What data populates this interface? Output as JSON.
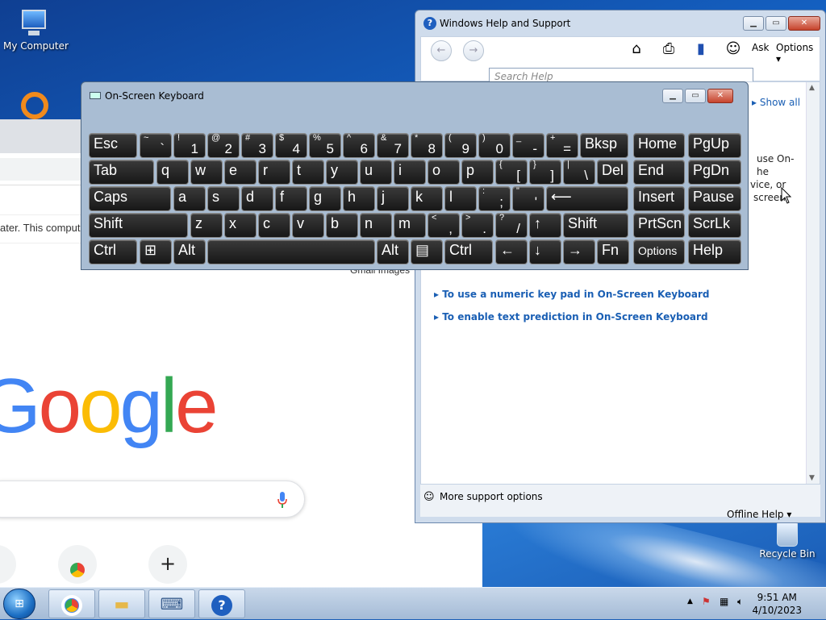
{
  "desktop": {
    "icons": {
      "my_computer": "My Computer",
      "recycle_bin": "Recycle Bin"
    }
  },
  "browser": {
    "info_text": "ater. This compute",
    "top_links": "Gmail   Images",
    "logo_text": "Google",
    "logo_colors": [
      "#4285F4",
      "#EA4335",
      "#FBBC05",
      "#4285F4",
      "#34A853",
      "#EA4335"
    ],
    "shortcut_plus": "+"
  },
  "help_window": {
    "title": "Windows Help and Support",
    "toolbar": {
      "ask": "Ask",
      "options": "Options"
    },
    "search_placeholder": "Search Help",
    "show_all": "Show all",
    "snippets": [
      "use On-",
      "he",
      "vice, or",
      "screen."
    ],
    "links": [
      "To use a numeric key pad in On-Screen Keyboard",
      "To enable text prediction in On-Screen Keyboard"
    ],
    "more_support": "More support options",
    "offline_help": "Offline Help"
  },
  "osk": {
    "title": "On-Screen Keyboard",
    "rows": [
      [
        {
          "main": "Esc"
        },
        {
          "sub": "~",
          "base": "`"
        },
        {
          "sub": "!",
          "base": "1"
        },
        {
          "sub": "@",
          "base": "2"
        },
        {
          "sub": "#",
          "base": "3"
        },
        {
          "sub": "$",
          "base": "4"
        },
        {
          "sub": "%",
          "base": "5"
        },
        {
          "sub": "^",
          "base": "6"
        },
        {
          "sub": "&",
          "base": "7"
        },
        {
          "sub": "*",
          "base": "8"
        },
        {
          "sub": "(",
          "base": "9"
        },
        {
          "sub": ")",
          "base": "0"
        },
        {
          "sub": "_",
          "base": "-"
        },
        {
          "sub": "+",
          "base": "="
        },
        {
          "main": "Bksp"
        },
        {
          "main": "Home"
        },
        {
          "main": "PgUp"
        }
      ],
      [
        {
          "main": "Tab"
        },
        {
          "main": "q"
        },
        {
          "main": "w"
        },
        {
          "main": "e"
        },
        {
          "main": "r"
        },
        {
          "main": "t"
        },
        {
          "main": "y"
        },
        {
          "main": "u"
        },
        {
          "main": "i"
        },
        {
          "main": "o"
        },
        {
          "main": "p"
        },
        {
          "sub": "{",
          "base": "["
        },
        {
          "sub": "}",
          "base": "]"
        },
        {
          "sub": "|",
          "base": "\\"
        },
        {
          "main": "Del"
        },
        {
          "main": "End"
        },
        {
          "main": "PgDn"
        }
      ],
      [
        {
          "main": "Caps"
        },
        {
          "main": "a"
        },
        {
          "main": "s"
        },
        {
          "main": "d"
        },
        {
          "main": "f"
        },
        {
          "main": "g"
        },
        {
          "main": "h"
        },
        {
          "main": "j"
        },
        {
          "main": "k"
        },
        {
          "main": "l"
        },
        {
          "sub": ":",
          "base": ";"
        },
        {
          "sub": "\"",
          "base": "'"
        },
        {
          "main": "⟵"
        },
        {
          "main": "Insert"
        },
        {
          "main": "Pause"
        }
      ],
      [
        {
          "main": "Shift"
        },
        {
          "main": "z"
        },
        {
          "main": "x"
        },
        {
          "main": "c"
        },
        {
          "main": "v"
        },
        {
          "main": "b"
        },
        {
          "main": "n"
        },
        {
          "main": "m"
        },
        {
          "sub": "<",
          "base": ","
        },
        {
          "sub": ">",
          "base": "."
        },
        {
          "sub": "?",
          "base": "/"
        },
        {
          "main": "↑"
        },
        {
          "main": "Shift"
        },
        {
          "main": "PrtScn"
        },
        {
          "main": "ScrLk"
        }
      ],
      [
        {
          "main": "Ctrl"
        },
        {
          "main": "⊞"
        },
        {
          "main": "Alt"
        },
        {
          "main": ""
        },
        {
          "main": "Alt"
        },
        {
          "main": "▤"
        },
        {
          "main": "Ctrl"
        },
        {
          "main": "←"
        },
        {
          "main": "↓"
        },
        {
          "main": "→"
        },
        {
          "main": "Fn"
        },
        {
          "main": "Options"
        },
        {
          "main": "Help"
        }
      ]
    ]
  },
  "taskbar": {
    "time": "9:51 AM",
    "date": "4/10/2023"
  }
}
